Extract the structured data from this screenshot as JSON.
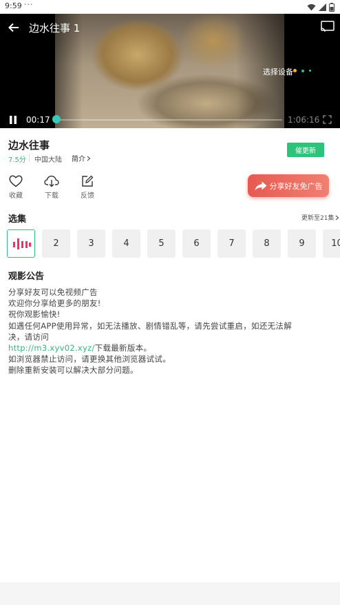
{
  "status_bar": {
    "time": "9:59",
    "dots": "···"
  },
  "player": {
    "title": "边水往事 1",
    "select_device": "选择设备",
    "device_dot_colors": [
      "#f2b632",
      "#2fc27a",
      "#39c9b8"
    ],
    "current_time": "00:17",
    "total_time": "1:06:16",
    "progress": 0.004
  },
  "show": {
    "title": "边水往事",
    "rating": "7.5分",
    "region": "中国大陆",
    "intro": "简介"
  },
  "urge_button": "催更新",
  "actions": [
    {
      "icon": "heart-icon",
      "label": "收藏"
    },
    {
      "icon": "download-icon",
      "label": "下载"
    },
    {
      "icon": "feedback-icon",
      "label": "反馈"
    }
  ],
  "share_button": "分享好友免广告",
  "episodes_section": {
    "title": "选集",
    "update_info": "更新至21集",
    "items": [
      "",
      "2",
      "3",
      "4",
      "5",
      "6",
      "7",
      "8",
      "9",
      "10"
    ]
  },
  "notice": {
    "title": "观影公告",
    "lines": [
      "分享好友可以免视频广告",
      "欢迎你分享给更多的朋友!",
      "祝你观影愉快!",
      "如遇任何APP使用异常，如无法播放、剧情错乱等，请先尝试重启，如还无法解",
      "决，请访问"
    ],
    "link": "http://m3.xyv02.xyz/",
    "link_suffix": "下载最新版本。",
    "tail_lines": [
      "如浏览器禁止访问，请更换其他浏览器试试。",
      "删除重新安装可以解决大部分问题。"
    ]
  },
  "colors": {
    "accent": "#2fc27a",
    "share": "#e65a52",
    "active_bars": "#e8336b"
  }
}
